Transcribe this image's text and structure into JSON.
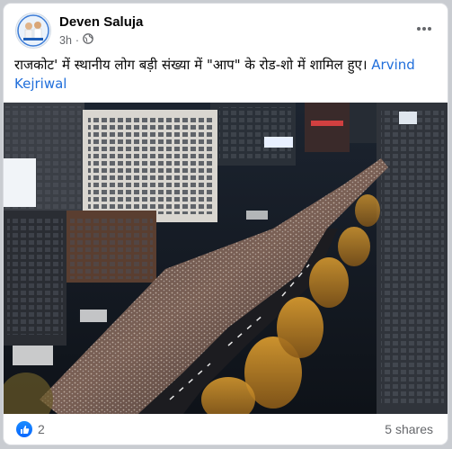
{
  "post": {
    "author": "Deven Saluja",
    "time": "3h",
    "separator": "·",
    "audience_icon": "globe-icon",
    "text_main": "राजकोट' में स्थानीय लोग बड़ी संख्या में \"आप\" के रोड-शो में शामिल हुए। ",
    "text_link": "Arvind Kejriwal"
  },
  "stats": {
    "reactions_count": "2",
    "shares": "5 shares"
  },
  "colors": {
    "link": "#216fdb",
    "like_blue": "#0866ff",
    "meta_gray": "#65676b"
  }
}
